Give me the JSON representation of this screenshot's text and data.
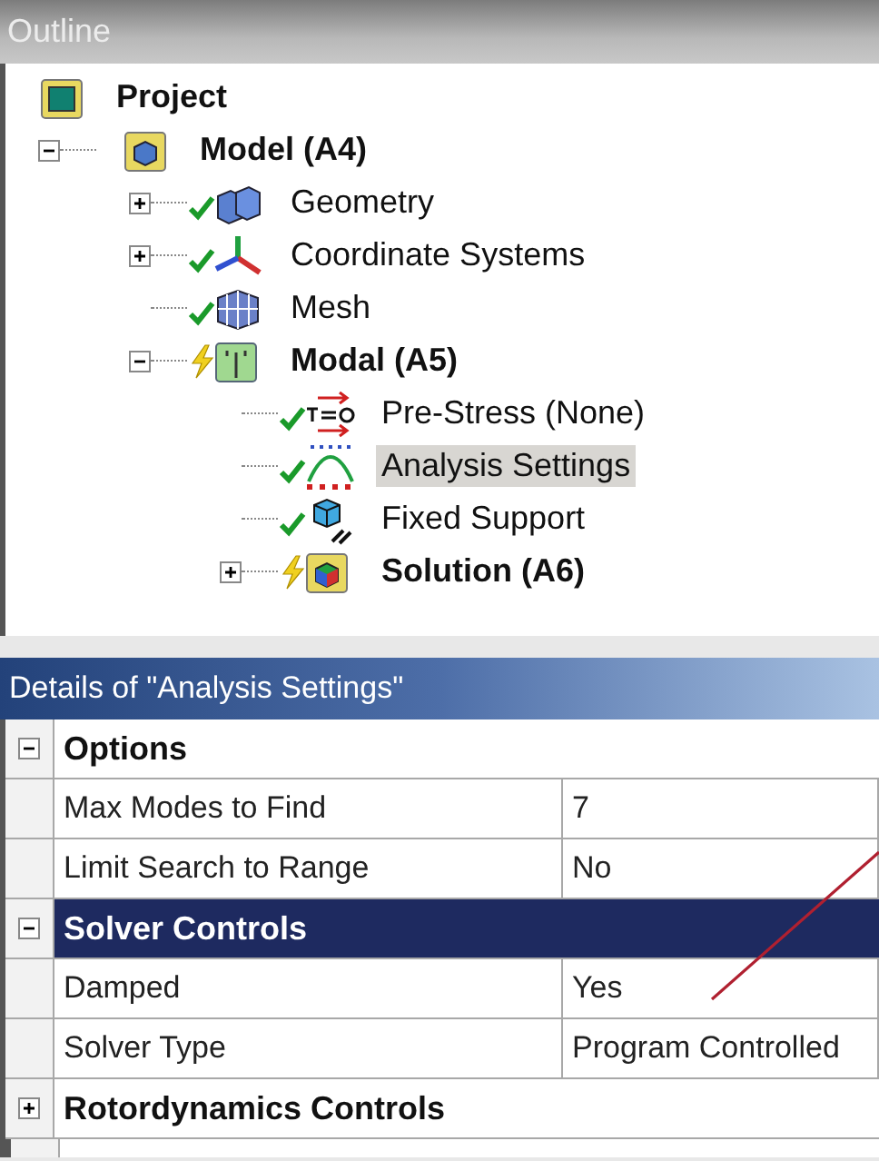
{
  "outline": {
    "title": "Outline",
    "tree": [
      {
        "label": "Project",
        "kind": "project",
        "bold": true,
        "selected": false,
        "children": [
          {
            "label": "Model (A4)",
            "kind": "model",
            "bold": true,
            "expanded": true,
            "selected": false,
            "children": [
              {
                "label": "Geometry",
                "kind": "geometry",
                "bold": false,
                "expanded": false,
                "up_to_date": true,
                "selected": false
              },
              {
                "label": "Coordinate Systems",
                "kind": "coordinates",
                "bold": false,
                "expanded": false,
                "up_to_date": true,
                "selected": false
              },
              {
                "label": "Mesh",
                "kind": "mesh",
                "bold": false,
                "up_to_date": true,
                "selected": false
              },
              {
                "label": "Modal (A5)",
                "kind": "modal",
                "bold": true,
                "expanded": true,
                "up_to_date": false,
                "selected": false,
                "children": [
                  {
                    "label": "Pre-Stress (None)",
                    "kind": "prestress",
                    "bold": false,
                    "up_to_date": true,
                    "selected": false
                  },
                  {
                    "label": "Analysis Settings",
                    "kind": "settings",
                    "bold": false,
                    "up_to_date": true,
                    "selected": true
                  },
                  {
                    "label": "Fixed Support",
                    "kind": "support",
                    "bold": false,
                    "up_to_date": true,
                    "selected": false
                  },
                  {
                    "label": "Solution (A6)",
                    "kind": "solution",
                    "bold": true,
                    "expanded": false,
                    "up_to_date": false,
                    "selected": false
                  }
                ]
              }
            ]
          }
        ]
      }
    ]
  },
  "details": {
    "title": "Details of \"Analysis Settings\"",
    "rows": [
      {
        "kind": "group",
        "label": "Options",
        "expanded": true,
        "selected": false
      },
      {
        "kind": "property",
        "name": "Max Modes to Find",
        "value": "7"
      },
      {
        "kind": "property",
        "name": "Limit Search to Range",
        "value": "No"
      },
      {
        "kind": "group",
        "label": "Solver Controls",
        "expanded": true,
        "selected": true
      },
      {
        "kind": "property",
        "name": "Damped",
        "value": "Yes"
      },
      {
        "kind": "property",
        "name": "Solver Type",
        "value": "Program Controlled"
      },
      {
        "kind": "group",
        "label": "Rotordynamics Controls",
        "expanded": false,
        "selected": false
      }
    ]
  }
}
